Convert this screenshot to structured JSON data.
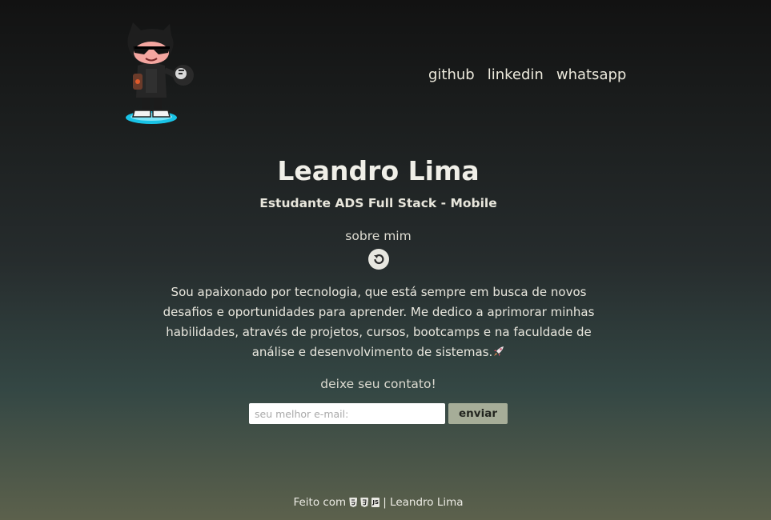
{
  "header": {
    "nav": [
      {
        "label": "github"
      },
      {
        "label": "linkedin"
      },
      {
        "label": "whatsapp"
      }
    ]
  },
  "hero": {
    "name": "Leandro Lima",
    "subtitle": "Estudante ADS Full Stack - Mobile"
  },
  "about": {
    "label": "sobre mim",
    "text": "Sou apaixonado por tecnologia, que está sempre em busca de novos desafios e oportunidades para aprender. Me dedico a aprimorar minhas habilidades, através de projetos, cursos, bootcamps e na faculdade de análise e desenvolvimento de sistemas."
  },
  "contact": {
    "label": "deixe seu contato!",
    "email_placeholder": "seu melhor e-mail:",
    "send_label": "enviar"
  },
  "footer": {
    "made_with": "Feito com",
    "author": "| Leandro Lima",
    "icons": [
      "html5-icon",
      "css3-icon",
      "js-icon"
    ],
    "js_icon_text": "JS"
  },
  "colors": {
    "accent_button": "#a6ad98",
    "text": "#e8e8e2",
    "gradient_top": "#121212",
    "gradient_bottom": "#5c614c"
  }
}
